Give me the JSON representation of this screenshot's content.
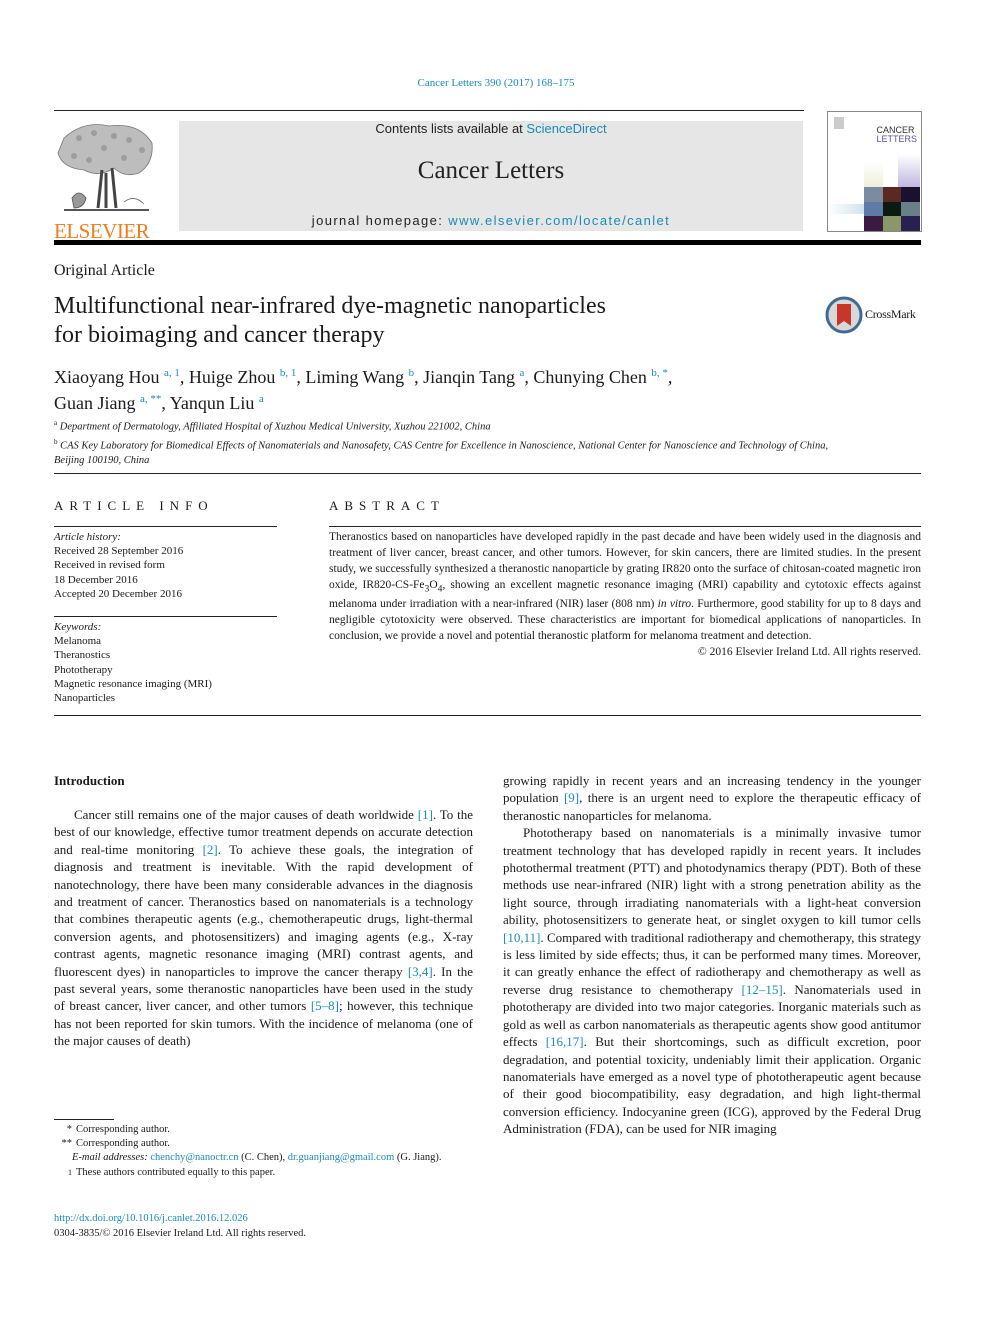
{
  "header": {
    "citation": "Cancer Letters 390 (2017) 168–175",
    "contents_prefix": "Contents lists available at ",
    "contents_link": "ScienceDirect",
    "journal_name": "Cancer Letters",
    "homepage_prefix": "journal homepage: ",
    "homepage_link": "www.elsevier.com/locate/canlet",
    "publisher_logo_text": "ELSEVIER",
    "cover_title_line1": "CANCER",
    "cover_title_line2": "LETTERS",
    "colors": {
      "link": "#1a8bb8",
      "elsevier_orange": "#f07d1b",
      "banner_bg": "#e6e6e6"
    }
  },
  "article": {
    "type": "Original Article",
    "title_line1": "Multifunctional near-infrared dye-magnetic nanoparticles",
    "title_line2": "for bioimaging and cancer therapy",
    "crossmark_label": "CrossMark",
    "authors": [
      {
        "name": "Xiaoyang Hou",
        "sup": "a, 1"
      },
      {
        "name": "Huige Zhou",
        "sup": "b, 1"
      },
      {
        "name": "Liming Wang",
        "sup": "b"
      },
      {
        "name": "Jianqin Tang",
        "sup": "a"
      },
      {
        "name": "Chunying Chen",
        "sup": "b, *"
      },
      {
        "name": "Guan Jiang",
        "sup": "a, **"
      },
      {
        "name": "Yanqun Liu",
        "sup": "a"
      }
    ],
    "affiliations": [
      {
        "key": "a",
        "text": "Department of Dermatology, Affiliated Hospital of Xuzhou Medical University, Xuzhou 221002, China"
      },
      {
        "key": "b",
        "text": "CAS Key Laboratory for Biomedical Effects of Nanomaterials and Nanosafety, CAS Centre for Excellence in Nanoscience, National Center for Nanoscience and Technology of China, Beijing 100190, China"
      }
    ]
  },
  "article_info": {
    "heading": "ARTICLE INFO",
    "history_label": "Article history:",
    "history": [
      "Received 28 September 2016",
      "Received in revised form",
      "18 December 2016",
      "Accepted 20 December 2016"
    ],
    "keywords_label": "Keywords:",
    "keywords": [
      "Melanoma",
      "Theranostics",
      "Phototherapy",
      "Magnetic resonance imaging (MRI)",
      "Nanoparticles"
    ]
  },
  "abstract": {
    "heading": "ABSTRACT",
    "text_part1": "Theranostics based on nanoparticles have developed rapidly in the past decade and have been widely used in the diagnosis and treatment of liver cancer, breast cancer, and other tumors. However, for skin cancers, there are limited studies. In the present study, we successfully synthesized a theranostic nanoparticle by grating IR820 onto the surface of chitosan-coated magnetic iron oxide, IR820-CS-Fe",
    "sub1": "3",
    "text_part2": "O",
    "sub2": "4",
    "text_part3": ", showing an excellent magnetic resonance imaging (MRI) capability and cytotoxic effects against melanoma under irradiation with a near-infrared (NIR) laser (808 nm) ",
    "italic": "in vitro",
    "text_part4": ". Furthermore, good stability for up to 8 days and negligible cytotoxicity were observed. These characteristics are important for biomedical applications of nanoparticles. In conclusion, we provide a novel and potential theranostic platform for melanoma treatment and detection.",
    "copyright": "© 2016 Elsevier Ireland Ltd. All rights reserved."
  },
  "body": {
    "intro_heading": "Introduction",
    "left_p1": [
      {
        "t": "Cancer still remains one of the major causes of death worldwide "
      },
      {
        "ref": "[1]"
      },
      {
        "t": ". To the best of our knowledge, effective tumor treatment depends on accurate detection and real-time monitoring "
      },
      {
        "ref": "[2]"
      },
      {
        "t": ". To achieve these goals, the integration of diagnosis and treatment is inevitable. With the rapid development of nanotechnology, there have been many considerable advances in the diagnosis and treatment of cancer. Theranostics based on nanomaterials is a technology that combines therapeutic agents (e.g., chemotherapeutic drugs, light-thermal conversion agents, and photosensitizers) and imaging agents (e.g., X-ray contrast agents, magnetic resonance imaging (MRI) contrast agents, and fluorescent dyes) in nanoparticles to improve the cancer therapy "
      },
      {
        "ref": "[3,4]"
      },
      {
        "t": ". In the past several years, some theranostic nanoparticles have been used in the study of breast cancer, liver cancer, and other tumors "
      },
      {
        "ref": "[5–8]"
      },
      {
        "t": "; however, this technique has not been reported for skin tumors. With the incidence of melanoma (one of the major causes of death)"
      }
    ],
    "right_p1": [
      {
        "t": "growing rapidly in recent years and an increasing tendency in the younger population "
      },
      {
        "ref": "[9]"
      },
      {
        "t": ", there is an urgent need to explore the therapeutic efficacy of theranostic nanoparticles for melanoma."
      }
    ],
    "right_p2": [
      {
        "t": "Phototherapy based on nanomaterials is a minimally invasive tumor treatment technology that has developed rapidly in recent years. It includes photothermal treatment (PTT) and photodynamics therapy (PDT). Both of these methods use near-infrared (NIR) light with a strong penetration ability as the light source, through irradiating nanomaterials with a light-heat conversion ability, photosensitizers to generate heat, or singlet oxygen to kill tumor cells "
      },
      {
        "ref": "[10,11]"
      },
      {
        "t": ". Compared with traditional radiotherapy and chemotherapy, this strategy is less limited by side effects; thus, it can be performed many times. Moreover, it can greatly enhance the effect of radiotherapy and chemotherapy as well as reverse drug resistance to chemotherapy "
      },
      {
        "ref": "[12–15]"
      },
      {
        "t": ". Nanomaterials used in phototherapy are divided into two major categories. Inorganic materials such as gold as well as carbon nanomaterials as therapeutic agents show good antitumor effects "
      },
      {
        "ref": "[16,17]"
      },
      {
        "t": ". But their shortcomings, such as difficult excretion, poor degradation, and potential toxicity, undeniably limit their application. Organic nanomaterials have emerged as a novel type of phototherapeutic agent because of their good biocompatibility, easy degradation, and high light-thermal conversion efficiency. Indocyanine green (ICG), approved by the Federal Drug Administration (FDA), can be used for NIR imaging"
      }
    ]
  },
  "footnotes": {
    "fn1_mark": "*",
    "fn1_text": "Corresponding author.",
    "fn2_mark": "**",
    "fn2_text": "Corresponding author.",
    "email_label": "E-mail addresses:",
    "email1": "chenchy@nanoctr.cn",
    "email1_owner": " (C. Chen), ",
    "email2": "dr.guanjiang@gmail.com",
    "email2_owner": " (G. Jiang).",
    "fn3_mark": "1",
    "fn3_text": "These authors contributed equally to this paper.",
    "doi": "http://dx.doi.org/10.1016/j.canlet.2016.12.026",
    "issn_line": "0304-3835/© 2016 Elsevier Ireland Ltd. All rights reserved."
  }
}
